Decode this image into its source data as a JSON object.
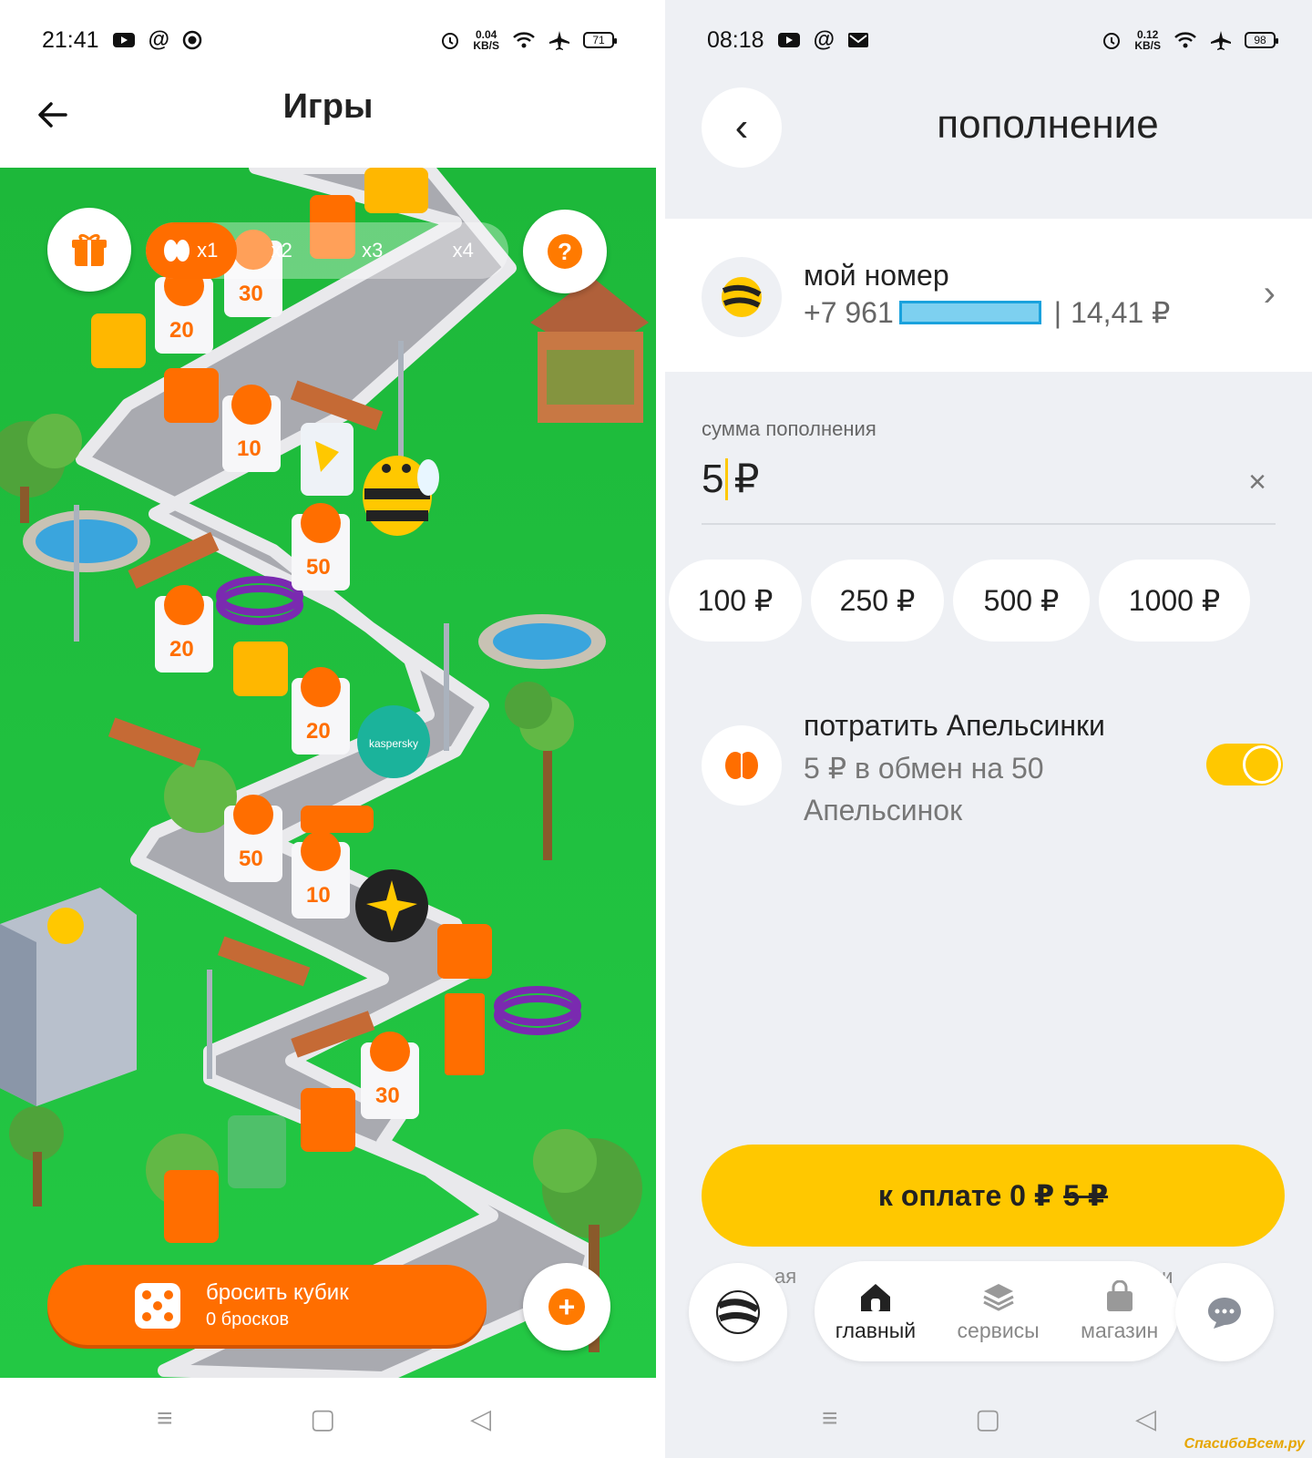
{
  "left": {
    "status": {
      "time": "21:41",
      "speed_value": "0.04",
      "speed_unit": "KB/S",
      "battery": "71"
    },
    "header": {
      "back_icon": "arrow-left-icon",
      "title": "Игры"
    },
    "game": {
      "multipliers": [
        {
          "label": "x1",
          "active": true
        },
        {
          "label": "x2",
          "active": false
        },
        {
          "label": "x3",
          "active": false
        },
        {
          "label": "x4",
          "active": false
        }
      ],
      "tile_values": [
        "30",
        "20",
        "10",
        "50",
        "20",
        "20",
        "50",
        "10",
        "30"
      ],
      "brand_tiles": [
        "kasperskу"
      ],
      "roll_button": {
        "label": "бросить кубик",
        "count": "0  бросков"
      },
      "help_symbol": "?",
      "plus_symbol": "+"
    },
    "nav": {
      "menu": "≡",
      "home": "▢",
      "back": "◁"
    }
  },
  "right": {
    "status": {
      "time": "08:18",
      "speed_value": "0.12",
      "speed_unit": "KB/S",
      "battery": "98"
    },
    "header": {
      "title": "пополнение",
      "back_symbol": "‹"
    },
    "account": {
      "name": "мой номер",
      "prefix": "+7 961",
      "separator": "|",
      "balance": "14,41 ₽",
      "chevron": "›"
    },
    "amount": {
      "label": "сумма пополнения",
      "digits": "5",
      "currency": "₽",
      "clear_symbol": "×"
    },
    "chips": [
      "100 ₽",
      "250 ₽",
      "500 ₽",
      "1000 ₽"
    ],
    "spend": {
      "title": "потратить Апельсинки",
      "subtitle": "5 ₽ в обмен на 50 Апельсинок",
      "enabled": true
    },
    "pay": {
      "label": "к оплате 0 ₽",
      "old": "5 ₽"
    },
    "tabs": [
      {
        "label": "главный",
        "icon": "home-icon",
        "active": true
      },
      {
        "label": "сервисы",
        "icon": "layers-icon",
        "active": false
      },
      {
        "label": "магазин",
        "icon": "shopping-bag-icon",
        "active": false
      }
    ],
    "tabbar_ghost": {
      "left": "ая",
      "right": "ми"
    },
    "nav": {
      "menu": "≡",
      "home": "▢",
      "back": "◁"
    },
    "watermark": "СпасибоВсем.ру"
  },
  "colors": {
    "accent_orange": "#ff6e00",
    "accent_yellow": "#ffc800",
    "grass_green": "#1fbe3a"
  }
}
